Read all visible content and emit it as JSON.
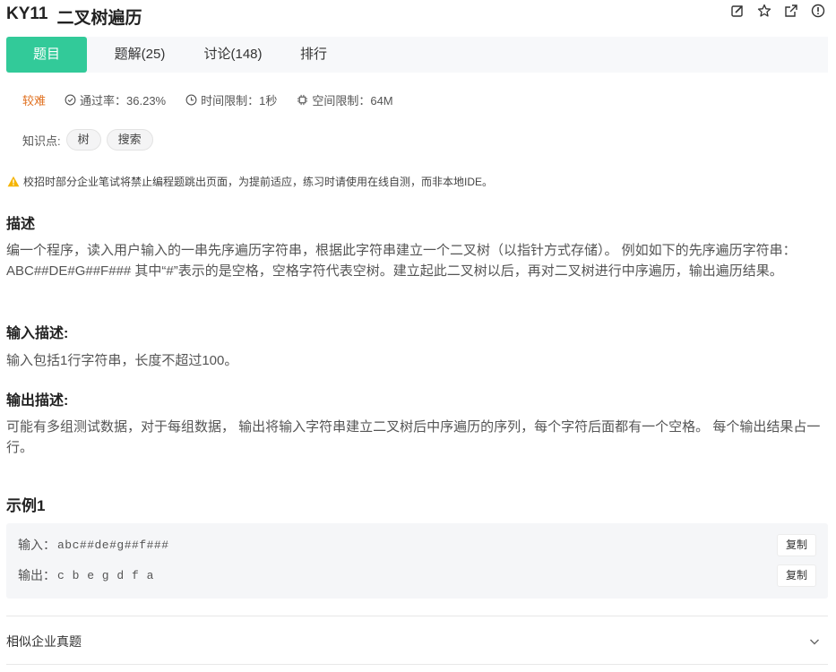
{
  "problem": {
    "id": "KY11",
    "title": "二叉树遍历"
  },
  "title_icons": [
    "edit-icon",
    "star-icon",
    "share-icon",
    "info-icon"
  ],
  "tabs": [
    {
      "label": "题目",
      "active": true
    },
    {
      "label": "题解(25)",
      "active": false
    },
    {
      "label": "讨论(148)",
      "active": false
    },
    {
      "label": "排行",
      "active": false
    }
  ],
  "meta": {
    "difficulty": "较难",
    "pass_rate": "通过率：36.23%",
    "time_limit": "时间限制：1秒",
    "space_limit": "空间限制：64M"
  },
  "knowledge": {
    "label": "知识点:",
    "tags": [
      "树",
      "搜索"
    ]
  },
  "warning": "校招时部分企业笔试将禁止编程题跳出页面，为提前适应，练习时请使用在线自测，而非本地IDE。",
  "description": {
    "heading": "描述",
    "text": "编一个程序，读入用户输入的一串先序遍历字符串，根据此字符串建立一个二叉树（以指针方式存储）。 例如如下的先序遍历字符串： ABC##DE#G##F### 其中“#”表示的是空格，空格字符代表空树。建立起此二叉树以后，再对二叉树进行中序遍历，输出遍历结果。"
  },
  "input_desc": {
    "heading": "输入描述:",
    "text": "输入包括1行字符串，长度不超过100。"
  },
  "output_desc": {
    "heading": "输出描述:",
    "text": "可能有多组测试数据，对于每组数据， 输出将输入字符串建立二叉树后中序遍历的序列，每个字符后面都有一个空格。 每个输出结果占一行。"
  },
  "example": {
    "heading": "示例1",
    "input_label": "输入：",
    "input_value": "abc##de#g##f###",
    "output_label": "输出：",
    "output_value": "c b e g d f a",
    "copy_label": "复制"
  },
  "similar": {
    "label": "相似企业真题"
  },
  "colors": {
    "accent": "#32ca99",
    "difficulty": "#e0701f",
    "warning": "#f5b400"
  }
}
